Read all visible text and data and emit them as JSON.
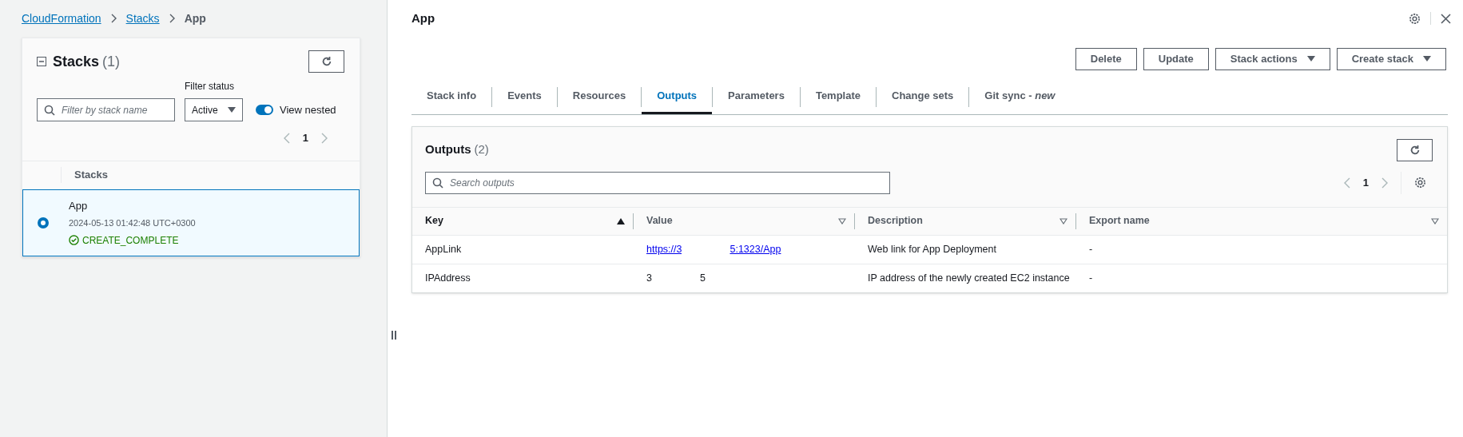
{
  "breadcrumb": [
    {
      "label": "CloudFormation",
      "link": true
    },
    {
      "label": "Stacks",
      "link": true
    },
    {
      "label": "App",
      "link": false
    }
  ],
  "stacks_panel": {
    "title": "Stacks",
    "count": "(1)",
    "filter_placeholder": "Filter by stack name",
    "filter_status_label": "Filter status",
    "filter_status": "Active",
    "view_nested": {
      "label": "View nested",
      "on": true
    },
    "page": "1",
    "column": "Stacks",
    "rows": [
      {
        "name": "App",
        "date": "2024-05-13 01:42:48 UTC+0300",
        "status": "CREATE_COMPLETE",
        "selected": true
      }
    ]
  },
  "detail": {
    "title": "App",
    "buttons": [
      {
        "label": "Delete",
        "dropdown": false
      },
      {
        "label": "Update",
        "dropdown": false
      },
      {
        "label": "Stack actions",
        "dropdown": true
      },
      {
        "label": "Create stack",
        "dropdown": true
      }
    ],
    "tabs": [
      {
        "label": "Stack info",
        "selected": false
      },
      {
        "label": "Events",
        "selected": false
      },
      {
        "label": "Resources",
        "selected": false
      },
      {
        "label": "Outputs",
        "selected": true
      },
      {
        "label": "Parameters",
        "selected": false
      },
      {
        "label": "Template",
        "selected": false
      },
      {
        "label": "Change sets",
        "selected": false
      },
      {
        "label": "Git sync - *new*",
        "selected": false
      }
    ],
    "outputs": {
      "title": "Outputs",
      "count": "(2)",
      "search_placeholder": "Search outputs",
      "page": "1",
      "columns": [
        {
          "label": "Key",
          "sorted": true
        },
        {
          "label": "Value",
          "sorted": false
        },
        {
          "label": "Description",
          "sorted": false
        },
        {
          "label": "Export name",
          "sorted": false
        }
      ],
      "rows": [
        {
          "key": "AppLink",
          "value_start": "https://3",
          "value_end": "5:1323/App",
          "value_link": true,
          "description": "Web link for App Deployment",
          "export_name": "-"
        },
        {
          "key": "IPAddress",
          "value_start": "3",
          "value_end": "5",
          "value_link": false,
          "description": "IP address of the newly created EC2 instance",
          "export_name": "-"
        }
      ]
    }
  }
}
